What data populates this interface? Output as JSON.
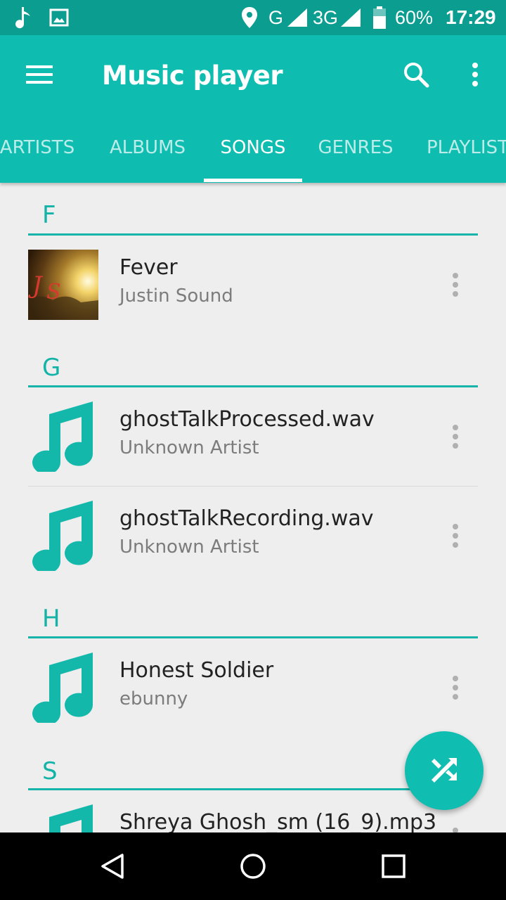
{
  "status_bar": {
    "network_1": "G",
    "network_2": "3G",
    "battery_percent": "60%",
    "time": "17:29",
    "icons": [
      "music-note-icon",
      "image-icon",
      "location-icon",
      "signal-icon",
      "battery-icon"
    ]
  },
  "app_bar": {
    "title": "Music player",
    "icons": [
      "menu-icon",
      "search-icon",
      "more-vert-icon"
    ]
  },
  "tabs": [
    {
      "label": "ARTISTS",
      "active": false
    },
    {
      "label": "ALBUMS",
      "active": false
    },
    {
      "label": "SONGS",
      "active": true
    },
    {
      "label": "GENRES",
      "active": false
    },
    {
      "label": "PLAYLISTS",
      "active": false
    }
  ],
  "sections": [
    {
      "letter": "F",
      "songs": [
        {
          "title": "Fever",
          "artist": "Justin Sound",
          "art": "album-art"
        }
      ]
    },
    {
      "letter": "G",
      "songs": [
        {
          "title": "ghostTalkProcessed.wav",
          "artist": "Unknown Artist",
          "art": "music-note-icon"
        },
        {
          "title": "ghostTalkRecording.wav",
          "artist": "Unknown Artist",
          "art": "music-note-icon"
        }
      ]
    },
    {
      "letter": "H",
      "songs": [
        {
          "title": "Honest Soldier",
          "artist": "ebunny",
          "art": "music-note-icon"
        }
      ]
    },
    {
      "letter": "S",
      "songs": [
        {
          "title": "Shreya Ghosh_sm (16_9).mp3",
          "artist": "",
          "art": "music-note-icon"
        }
      ]
    }
  ],
  "fab": {
    "icon": "shuffle-icon"
  },
  "nav_bar": {
    "icons": [
      "back-icon",
      "home-icon",
      "recents-icon"
    ]
  },
  "colors": {
    "status_bar": "#0c9d91",
    "primary": "#0fbcb0",
    "accent": "#13b3a7",
    "background": "#eeeeee"
  }
}
